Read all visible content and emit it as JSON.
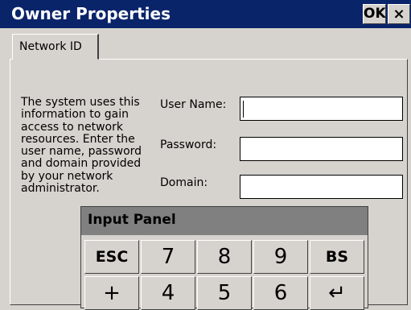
{
  "window": {
    "title": "Owner Properties",
    "ok_label": "OK",
    "close_label": "×"
  },
  "tabs": [
    {
      "label": "Network ID",
      "active": true
    }
  ],
  "description": "The system uses this information to gain access to network resources. Enter the user name, password and domain provided by your network administrator.",
  "form": {
    "user_name": {
      "label": "User Name:",
      "value": ""
    },
    "password": {
      "label": "Password:",
      "value": ""
    },
    "domain": {
      "label": "Domain:",
      "value": ""
    }
  },
  "input_panel": {
    "title": "Input Panel",
    "row1": [
      "ESC",
      "7",
      "8",
      "9",
      "BS"
    ],
    "row2": [
      "+",
      "4",
      "5",
      "6",
      "↵"
    ]
  },
  "colors": {
    "titlebar": "#0a246a",
    "face": "#d6d3ce",
    "input_panel_title": "#808080"
  }
}
